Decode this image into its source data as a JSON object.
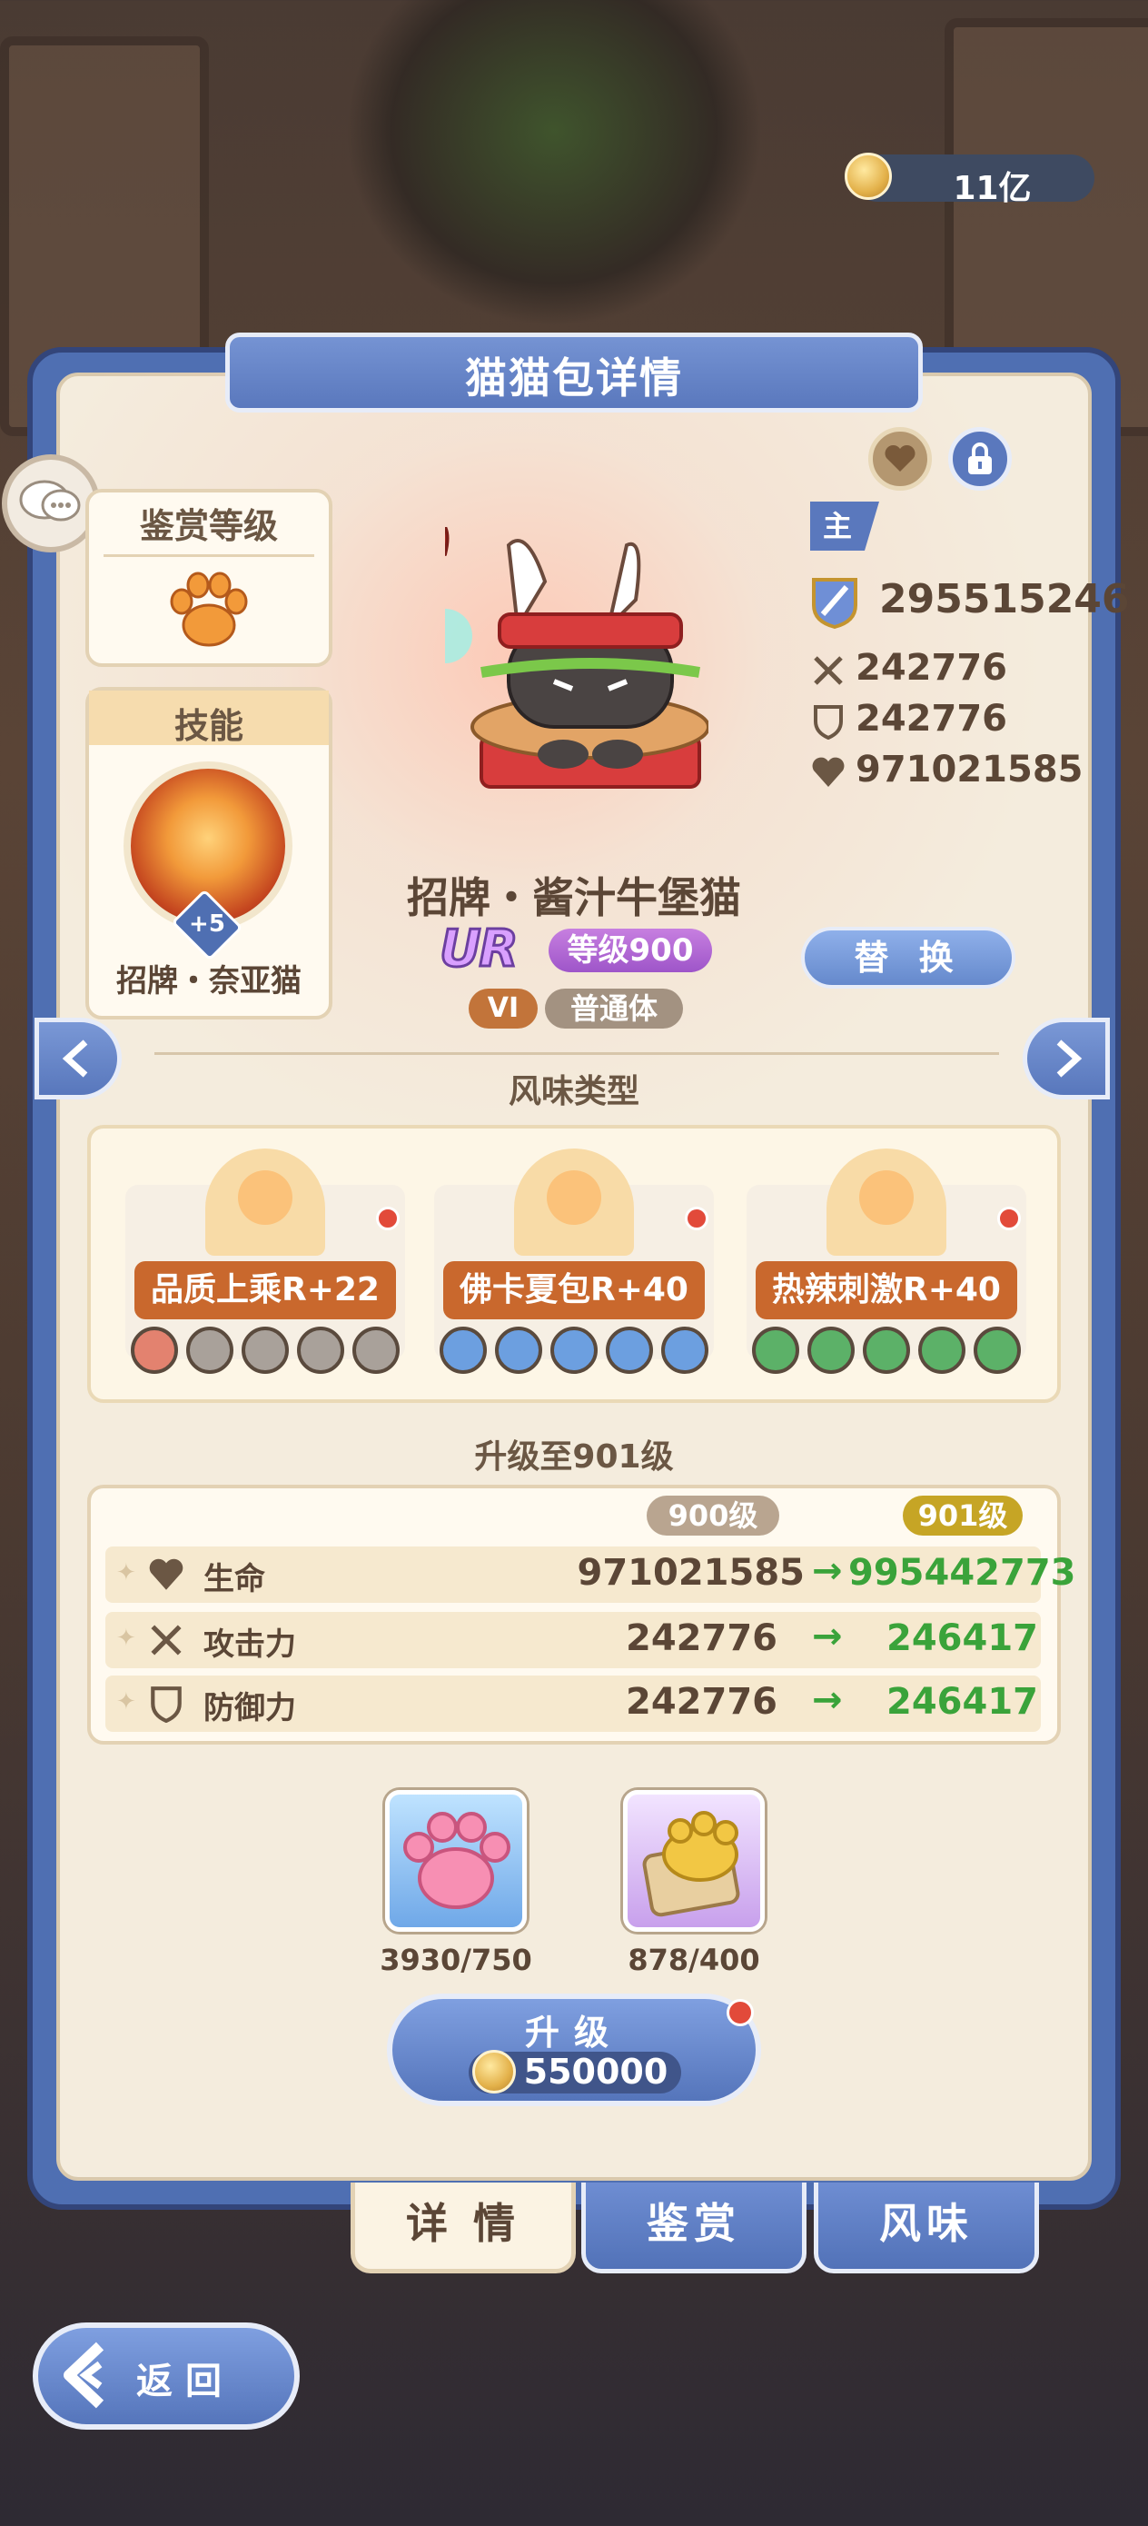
{
  "header": {
    "currency_value": "11亿",
    "title": "猫猫包详情"
  },
  "left": {
    "rank_title": "鉴赏等级",
    "skill_title": "技能",
    "skill_badge": "+5",
    "skill_name": "招牌・奈亚猫"
  },
  "character": {
    "name": "招牌・酱汁牛堡猫",
    "rarity": "UR",
    "level": "等级900",
    "grade": "VI",
    "type": "普通体",
    "main_tag": "主",
    "power": "295515246",
    "attack": "242776",
    "defense": "242776",
    "hp": "971021585",
    "replace_label": "替 换"
  },
  "flavor": {
    "title": "风味类型",
    "items": [
      {
        "label": "品质上乘R+22",
        "color": "#e3826f"
      },
      {
        "label": "佛卡夏包R+40",
        "color": "#6c9fe0"
      },
      {
        "label": "热辣刺激R+40",
        "color": "#5cb168"
      }
    ]
  },
  "upgrade": {
    "title": "升级至901级",
    "from_level": "900级",
    "to_level": "901级",
    "rows": [
      {
        "label": "生命",
        "old": "971021585",
        "new": "995442773"
      },
      {
        "label": "攻击力",
        "old": "242776",
        "new": "246417"
      },
      {
        "label": "防御力",
        "old": "242776",
        "new": "246417"
      }
    ],
    "materials": [
      {
        "count": "3930/750"
      },
      {
        "count": "878/400"
      }
    ],
    "button_label": "升级",
    "cost": "550000"
  },
  "tabs": [
    "详 情",
    "鉴赏",
    "风味"
  ],
  "back_label": "返回",
  "colors": {
    "accent_blue": "#5a78bd",
    "panel": "#f4ecdd",
    "green": "#3aa33a",
    "orange": "#c9682d"
  }
}
